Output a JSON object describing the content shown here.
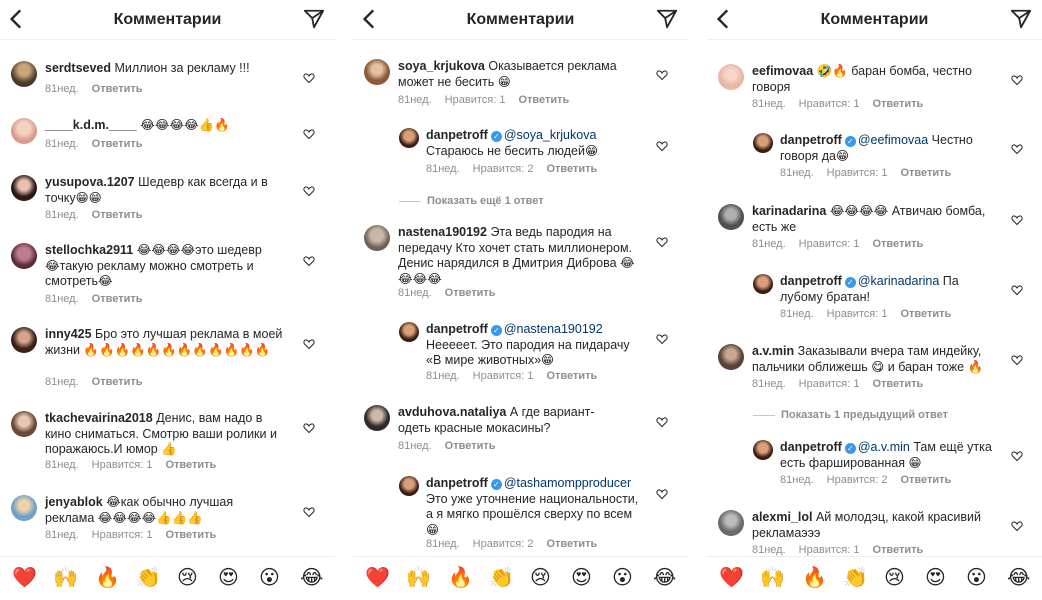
{
  "panels": [
    {
      "title": "Комментарии",
      "comments": [
        {
          "user": "serdtseved",
          "text": "Миллион за рекламу !!!",
          "time": "81нед.",
          "likes": "",
          "reply": "Ответить"
        },
        {
          "user": "____k.d.m.____",
          "text": "😂😂😂😂👍🔥",
          "time": "81нед.",
          "likes": "",
          "reply": "Ответить"
        },
        {
          "user": "yusupova.1207",
          "text": "Шедевр как всегда и в точку😁😁",
          "time": "81нед.",
          "likes": "",
          "reply": "Ответить"
        },
        {
          "user": "stellochka2911",
          "text": "😂😂😂😂это шедевр 😂такую рекламу можно смотреть и смотреть😂",
          "time": "81нед.",
          "likes": "",
          "reply": "Ответить"
        },
        {
          "user": "inny425",
          "text": "Бро это лучшая реклама в моей жизни 🔥🔥🔥🔥🔥🔥🔥🔥🔥🔥🔥🔥",
          "time": "81нед.",
          "likes": "",
          "reply": "Ответить"
        },
        {
          "user": "tkachevairina2018",
          "text": "Денис, вам надо в кино сниматься. Смотрю ваши ролики и поражаюсь.И юмор 👍",
          "time": "81нед.",
          "likes": "Нравится: 1",
          "reply": "Ответить"
        },
        {
          "user": "jenyablok",
          "text": "😂как обычно лучшая реклама 😂😂😂😂👍👍👍",
          "time": "81нед.",
          "likes": "Нравится: 1",
          "reply": "Ответить"
        }
      ]
    },
    {
      "title": "Комментарии",
      "comments": [
        {
          "user": "soya_krjukova",
          "text": "Оказывается реклама может не бесить 😁",
          "time": "81нед.",
          "likes": "Нравится: 1",
          "reply": "Ответить"
        },
        {
          "user": "danpetroff",
          "mention": "@soya_krjukova",
          "text": "Стараюсь не бесить людей😁",
          "time": "81нед.",
          "likes": "Нравится: 2",
          "reply": "Ответить"
        },
        {
          "more": "Показать ещё 1 ответ"
        },
        {
          "user": "nastena190192",
          "text": "Эта ведь пародия на передачу Кто хочет стать миллионером. Денис нарядился в Дмитрия Диброва 😂😂😂😂",
          "time": "81нед.",
          "likes": "",
          "reply": "Ответить"
        },
        {
          "user": "danpetroff",
          "mention": "@nastena190192",
          "text": "Неееeeт. Это пародия на пидарачу «В мире животных»😁",
          "time": "81нед.",
          "likes": "Нравится: 1",
          "reply": "Ответить"
        },
        {
          "user": "avduhova.nataliya",
          "text": "А где вариант- одеть красные мокасины?",
          "time": "81нед.",
          "likes": "",
          "reply": "Ответить"
        },
        {
          "user": "danpetroff",
          "mention": "@tashamompproducer",
          "text": "Это уже уточнение национальности, а я мягко прошёлся сверху по всем 😁",
          "time": "81нед.",
          "likes": "Нравится: 2",
          "reply": "Ответить"
        }
      ]
    },
    {
      "title": "Комментарии",
      "comments": [
        {
          "user": "eefimovaa",
          "text": "🤣🔥 баран бомба, честно говоря",
          "time": "81нед.",
          "likes": "Нравится: 1",
          "reply": "Ответить"
        },
        {
          "user": "danpetroff",
          "mention": "@eefimovaa",
          "text": "Честно говоря да😁",
          "time": "81нед.",
          "likes": "Нравится: 1",
          "reply": "Ответить"
        },
        {
          "user": "karinadarina",
          "text": "😂😂😂😂 Атвичаю бомба, есть же",
          "time": "81нед.",
          "likes": "Нравится: 1",
          "reply": "Ответить"
        },
        {
          "user": "danpetroff",
          "mention": "@karinadarina",
          "text": "Па лубому братан!",
          "time": "81нед.",
          "likes": "Нравится: 1",
          "reply": "Ответить"
        },
        {
          "user": "a.v.min",
          "text": "Заказывали вчера там индейку, пальчики оближешь 😋 и баран тоже 🔥",
          "time": "81нед.",
          "likes": "Нравится: 1",
          "reply": "Ответить"
        },
        {
          "more": "Показать 1 предыдущий ответ"
        },
        {
          "user": "danpetroff",
          "mention": "@a.v.min",
          "text": "Там ещё утка есть фаршированная 😁",
          "time": "81нед.",
          "likes": "Нравится: 2",
          "reply": "Ответить"
        },
        {
          "user": "alexmi_lol",
          "text": "Ай молодэц, какой красивий рекламаэээ",
          "time": "81нед.",
          "likes": "Нравится: 1",
          "reply": "Ответить"
        }
      ]
    }
  ],
  "emoji_bar": [
    "❤️",
    "🙌",
    "🔥",
    "👏",
    "😢",
    "😍",
    "😮",
    "😂"
  ],
  "icons": {
    "back": "chevron-left-icon",
    "send": "paper-plane-icon",
    "like": "heart-icon",
    "verified": "verified-badge-icon"
  },
  "colors": {
    "text": "#262626",
    "meta": "#8e8e8e",
    "mention": "#00376b",
    "verified": "#3897f0"
  }
}
